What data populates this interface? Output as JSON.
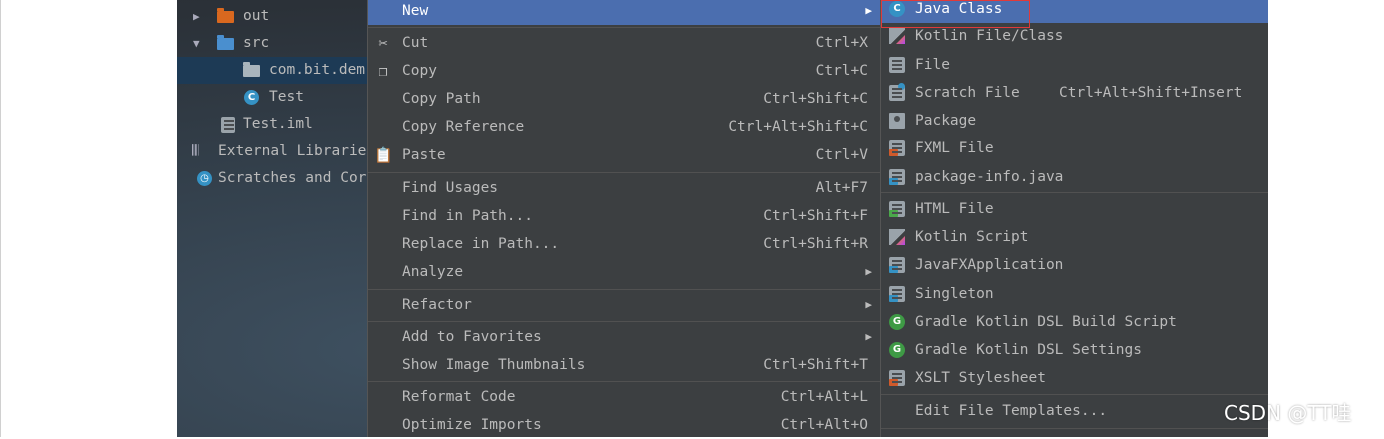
{
  "project_tree": {
    "items": [
      {
        "label": "out"
      },
      {
        "label": "src"
      },
      {
        "label": "com.bit.dem"
      },
      {
        "label": "Test"
      },
      {
        "label": "Test.iml"
      },
      {
        "label": "External Librarie"
      },
      {
        "label": "Scratches and Cor"
      }
    ]
  },
  "context_menu": {
    "new_label": "New",
    "cut": {
      "label": "Cut",
      "shortcut": "Ctrl+X"
    },
    "copy": {
      "label": "Copy",
      "shortcut": "Ctrl+C"
    },
    "copy_path": {
      "label": "Copy Path",
      "shortcut": "Ctrl+Shift+C"
    },
    "copy_reference": {
      "label": "Copy Reference",
      "shortcut": "Ctrl+Alt+Shift+C"
    },
    "paste": {
      "label": "Paste",
      "shortcut": "Ctrl+V"
    },
    "find_usages": {
      "label": "Find Usages",
      "shortcut": "Alt+F7"
    },
    "find_in_path": {
      "label": "Find in Path...",
      "shortcut": "Ctrl+Shift+F"
    },
    "replace_in_path": {
      "label": "Replace in Path...",
      "shortcut": "Ctrl+Shift+R"
    },
    "analyze": {
      "label": "Analyze"
    },
    "refactor": {
      "label": "Refactor"
    },
    "add_to_favorites": {
      "label": "Add to Favorites"
    },
    "show_image_thumbnails": {
      "label": "Show Image Thumbnails",
      "shortcut": "Ctrl+Shift+T"
    },
    "reformat_code": {
      "label": "Reformat Code",
      "shortcut": "Ctrl+Alt+L"
    },
    "optimize_imports": {
      "label": "Optimize Imports",
      "shortcut": "Ctrl+Alt+O"
    }
  },
  "new_submenu": {
    "java_class": "Java Class",
    "kotlin_file": "Kotlin File/Class",
    "file": "File",
    "scratch_file": {
      "label": "Scratch File",
      "shortcut": "Ctrl+Alt+Shift+Insert"
    },
    "package": "Package",
    "fxml_file": "FXML File",
    "package_info": "package-info.java",
    "html_file": "HTML File",
    "kotlin_script": "Kotlin Script",
    "javafx_app": "JavaFXApplication",
    "singleton": "Singleton",
    "gradle_build": "Gradle Kotlin DSL Build Script",
    "gradle_settings": "Gradle Kotlin DSL Settings",
    "xslt": "XSLT Stylesheet",
    "edit_templates": "Edit File Templates..."
  },
  "watermark": "CSDN @TT哇",
  "colors": {
    "highlight": "#4b6eaf",
    "menu_bg": "#3c3f41",
    "selection_border": "#e03a3a",
    "folder_out": "#d9681f",
    "folder_src": "#4a8fcf"
  }
}
